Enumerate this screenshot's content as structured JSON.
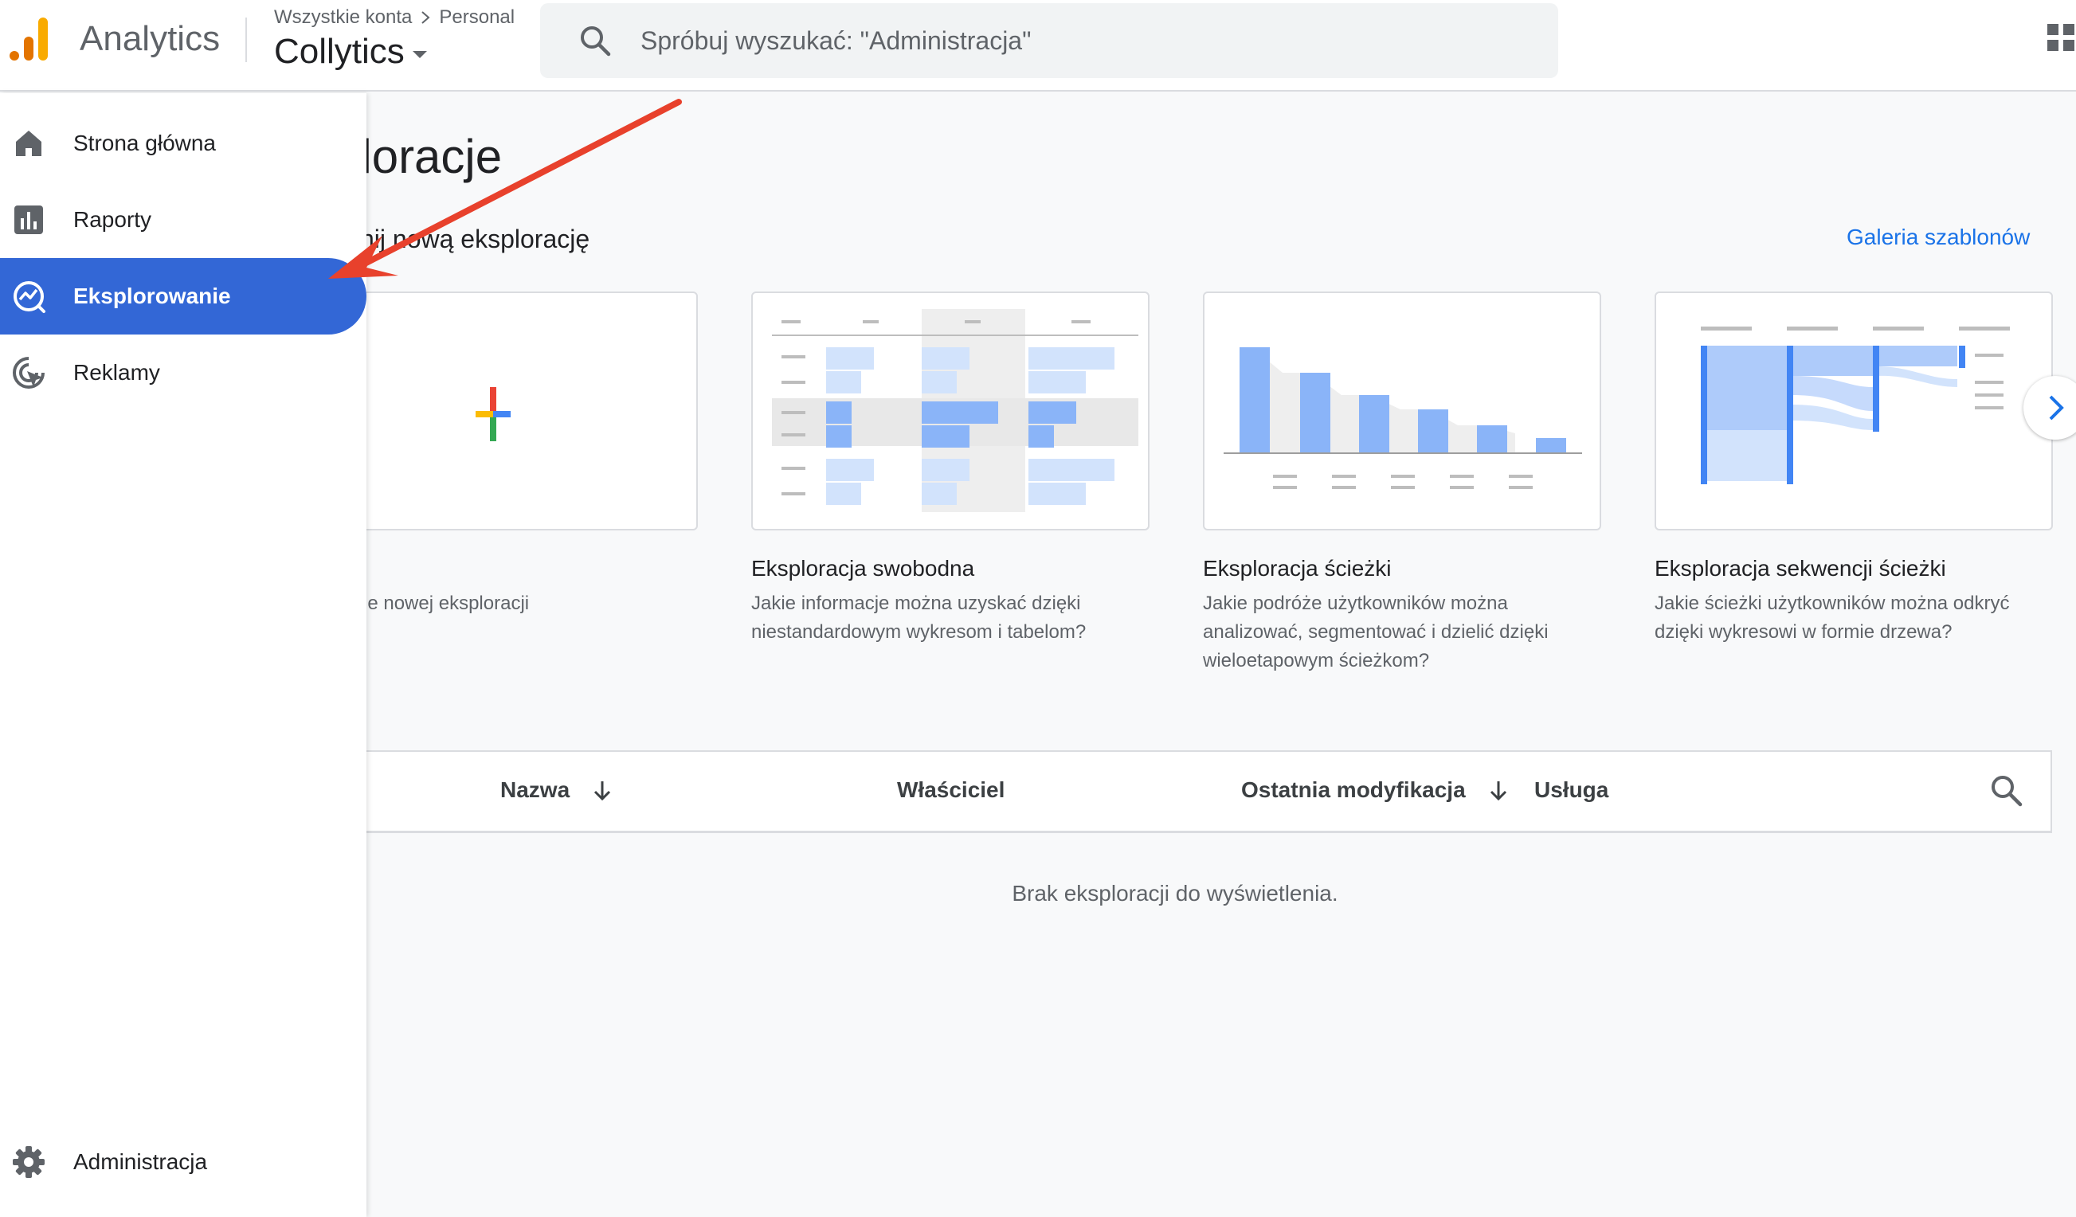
{
  "header": {
    "app_name": "Analytics",
    "breadcrumb": {
      "account": "Wszystkie konta",
      "property": "Personal"
    },
    "property_name": "Collytics",
    "search_placeholder": "Spróbuj wyszukać: \"Administracja\""
  },
  "sidebar": {
    "items": [
      {
        "label": "Strona główna",
        "icon": "home-icon"
      },
      {
        "label": "Raporty",
        "icon": "bar-chart-icon"
      },
      {
        "label": "Eksplorowanie",
        "icon": "explore-icon",
        "active": true
      },
      {
        "label": "Reklamy",
        "icon": "advertising-icon"
      }
    ],
    "admin": {
      "label": "Administracja",
      "icon": "gear-icon"
    }
  },
  "main": {
    "title": "ploracje",
    "start_label": "cznij nową eksplorację",
    "gallery_link": "Galeria szablonów",
    "cards": [
      {
        "title": "",
        "description": "ie nowej eksploracji",
        "thumbnail": "plus-icon"
      },
      {
        "title": "Eksploracja swobodna",
        "description": "Jakie informacje można uzyskać dzięki niestandardowym wykresom i tabelom?",
        "thumbnail": "freeform-table-icon"
      },
      {
        "title": "Eksploracja ścieżki",
        "description": "Jakie podróże użytkowników można analizować, segmentować i dzielić dzięki wieloetapowym ścieżkom?",
        "thumbnail": "funnel-icon"
      },
      {
        "title": "Eksploracja sekwencji ścieżki",
        "description": "Jakie ścieżki użytkowników można odkryć dzięki wykresowi w formie drzewa?",
        "thumbnail": "path-tree-icon"
      }
    ]
  },
  "table": {
    "columns": {
      "name": "Nazwa",
      "owner": "Właściciel",
      "modified": "Ostatnia modyfikacja",
      "service": "Usługa"
    },
    "empty_message": "Brak eksploracji do wyświetlenia."
  },
  "colors": {
    "accent": "#3367d6",
    "link": "#1a73e8",
    "annotation_arrow": "#e8412c"
  }
}
